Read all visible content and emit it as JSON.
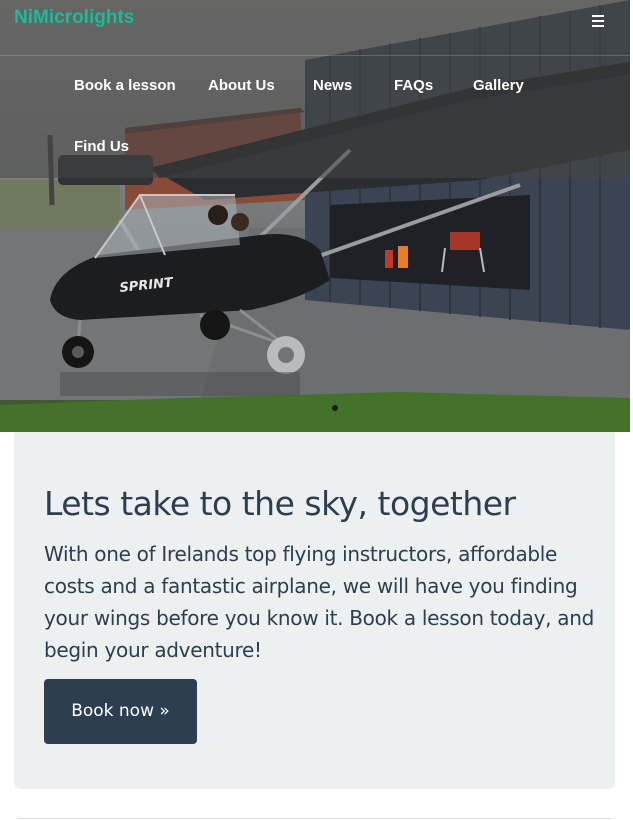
{
  "navbar": {
    "brand": "NiMicrolights",
    "menu_toggle_icon": "hamburger-icon",
    "links": [
      {
        "label": "Book a lesson"
      },
      {
        "label": "About Us"
      },
      {
        "label": "News"
      },
      {
        "label": "FAQs"
      },
      {
        "label": "Gallery"
      },
      {
        "label": "Find Us"
      }
    ]
  },
  "hero": {
    "aircraft_marking": "SPRINT",
    "carousel_indicators": 1
  },
  "jumbotron": {
    "title": "Lets take to the sky, together",
    "text": "With one of Irelands top flying instructors, affordable costs and a fantastic airplane, we will have you finding your wings before you know it. Book a lesson today, and begin your adventure!",
    "button_label": "Book now »"
  },
  "colors": {
    "brand": "#18bc9c",
    "primary": "#2c3e50",
    "jumbotron_bg": "#ecf0f1"
  }
}
